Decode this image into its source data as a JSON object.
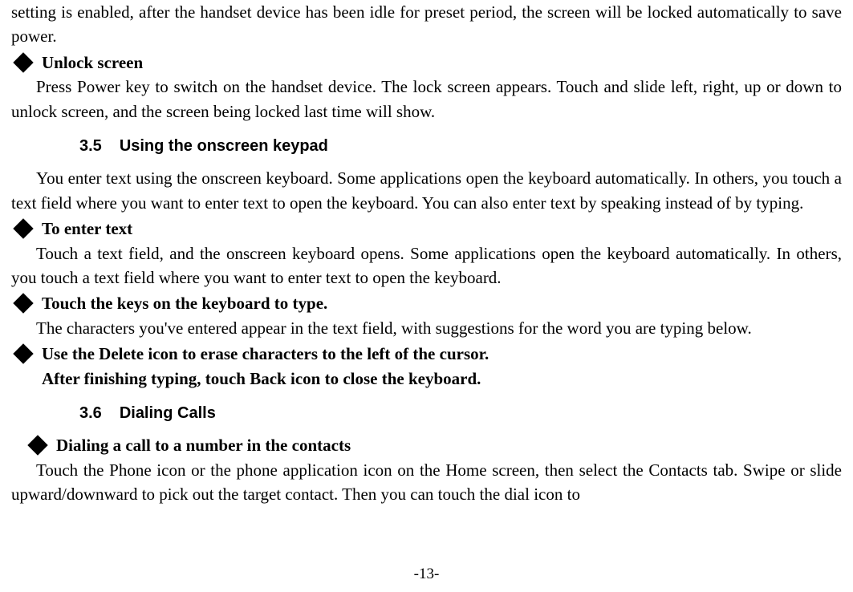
{
  "intro_frag1": "setting is enabled, after the handset device has been idle for preset period, the screen will be locked automatically to save power.",
  "bullet_unlock": "Unlock screen",
  "unlock_body": "Press Power key to switch on the handset device. The lock screen appears. Touch and slide left, right, up or down to unlock screen, and the screen being locked last time will show.",
  "sec35_num": "3.5",
  "sec35_title": "Using the onscreen keypad",
  "sec35_body": "You enter text using the onscreen keyboard. Some applications open the keyboard automatically. In others, you touch a text field where you want to enter text to open the keyboard. You can also enter text by speaking instead of by typing.",
  "bullet_enter": "To enter text",
  "enter_body": "Touch a text field, and the onscreen keyboard opens. Some applications open the keyboard automatically. In others, you touch a text field where you want to enter text to open the keyboard.",
  "bullet_touchkeys": "Touch the keys on the keyboard to type.",
  "touchkeys_body": "The characters you've entered appear in the text field, with suggestions for the word you are typing below.",
  "bullet_delete": "Use the Delete icon to erase characters to the left of the cursor.",
  "delete_followup": "After finishing typing, touch Back icon to close the keyboard.",
  "sec36_num": "3.6",
  "sec36_title": "Dialing Calls",
  "bullet_dialing": "Dialing a call to a number in the contacts",
  "dialing_body": "Touch the Phone icon or the phone application icon on the Home screen, then select the Contacts tab. Swipe or slide upward/downward to pick out the target contact. Then you can touch the dial icon to",
  "page_number": "-13-"
}
